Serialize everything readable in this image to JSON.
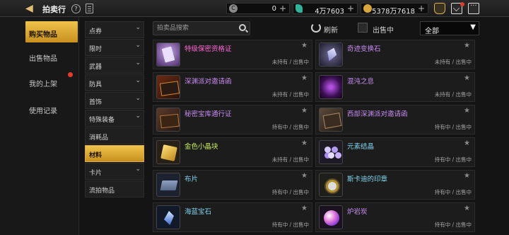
{
  "header": {
    "title": "拍卖行",
    "help_glyph": "?",
    "currencies": [
      {
        "icon": "coin-c-icon",
        "symbol": "C",
        "value": "0"
      },
      {
        "icon": "green-gem-icon",
        "symbol": "",
        "value": "4万7603"
      },
      {
        "icon": "gold-coin-icon",
        "symbol": "",
        "value": "5378万7618"
      }
    ],
    "plus": "+"
  },
  "nav": {
    "items": [
      {
        "label": "购买物品",
        "active": true
      },
      {
        "label": "出售物品",
        "active": false
      },
      {
        "label": "我的上架",
        "active": false
      },
      {
        "label": "使用记录",
        "active": false
      }
    ]
  },
  "categories": [
    {
      "label": "点券",
      "chevron": "⌄"
    },
    {
      "label": "限时",
      "chevron": "⌄"
    },
    {
      "label": "武器",
      "chevron": "⌄"
    },
    {
      "label": "防具",
      "chevron": "⌄"
    },
    {
      "label": "首饰",
      "chevron": "⌄"
    },
    {
      "label": "特殊装备",
      "chevron": "⌄"
    },
    {
      "label": "消耗品",
      "chevron": ""
    },
    {
      "label": "材料",
      "chevron": ""
    },
    {
      "label": "卡片",
      "chevron": "⌄"
    },
    {
      "label": "流拍物品",
      "chevron": ""
    }
  ],
  "search": {
    "placeholder": "拍卖品搜索"
  },
  "filters": {
    "refresh_label": "刷新",
    "on_sale_label": "出售中",
    "select_value": "全部"
  },
  "items": [
    {
      "name": "特级保密资格证",
      "status": "未持有 / 出售中"
    },
    {
      "name": "奇迹变换石",
      "status": "未持有 / 出售中"
    },
    {
      "name": "深渊派对邀请函",
      "status": "未持有 / 出售中"
    },
    {
      "name": "混沌之息",
      "status": "未持有 / 出售中"
    },
    {
      "name": "秘密宝库通行证",
      "status": "持有中 / 出售中"
    },
    {
      "name": "西部深渊派对邀请函",
      "status": "持有中 / 出售中"
    },
    {
      "name": "金色小晶块",
      "status": "未持有 / 出售中"
    },
    {
      "name": "元素结晶",
      "status": "持有中 / 出售中"
    },
    {
      "name": "布片",
      "status": "持有中 / 出售中"
    },
    {
      "name": "斯卡迪的印章",
      "status": "持有中 / 出售中"
    },
    {
      "name": "海蓝宝石",
      "status": "持有中 / 出售中"
    },
    {
      "name": "炉岩炭",
      "status": "持有中 / 出售中"
    }
  ],
  "star_glyph": "★"
}
